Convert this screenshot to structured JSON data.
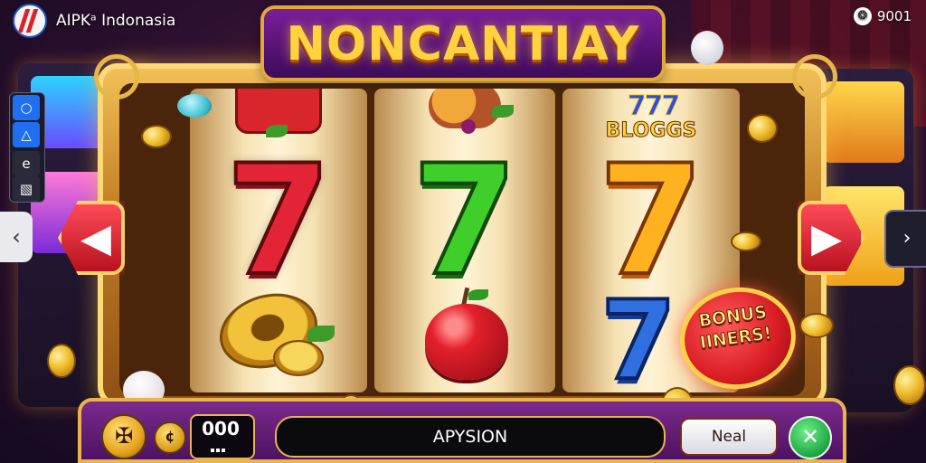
{
  "brand": {
    "name": "AIPKᵃ Indonasia",
    "logo_icon": "brand-logo-icon"
  },
  "counter": {
    "value": "9001",
    "icon": "badge-icon",
    "icon_glyph": "❂"
  },
  "title": "NONCANTIAY",
  "reels": {
    "reel_2_top_badge": {
      "digits": "777",
      "text": "BLOGGS"
    }
  },
  "bonus": {
    "line1": "BONUS",
    "line2": "IINERS!"
  },
  "nav": {
    "left_glyph": "‹",
    "right_glyph": "›",
    "left_arrow_glyph": "▶",
    "right_arrow_glyph": "▶"
  },
  "side_panel": {
    "items": [
      "○",
      "△",
      "e",
      "▧"
    ]
  },
  "controls": {
    "spin_glyph": "✠",
    "coin_glyph": "¢",
    "credit": "000",
    "message": "APYSION",
    "action_label": "Neal",
    "close_glyph": "✕"
  },
  "colors": {
    "accent_gold": "#e9b44c",
    "frame_purple": "#7e2b8e",
    "seven_red": "#e32437",
    "seven_green": "#3fce2a",
    "seven_orange": "#ffb21f",
    "seven_blue": "#2f6fe0"
  }
}
